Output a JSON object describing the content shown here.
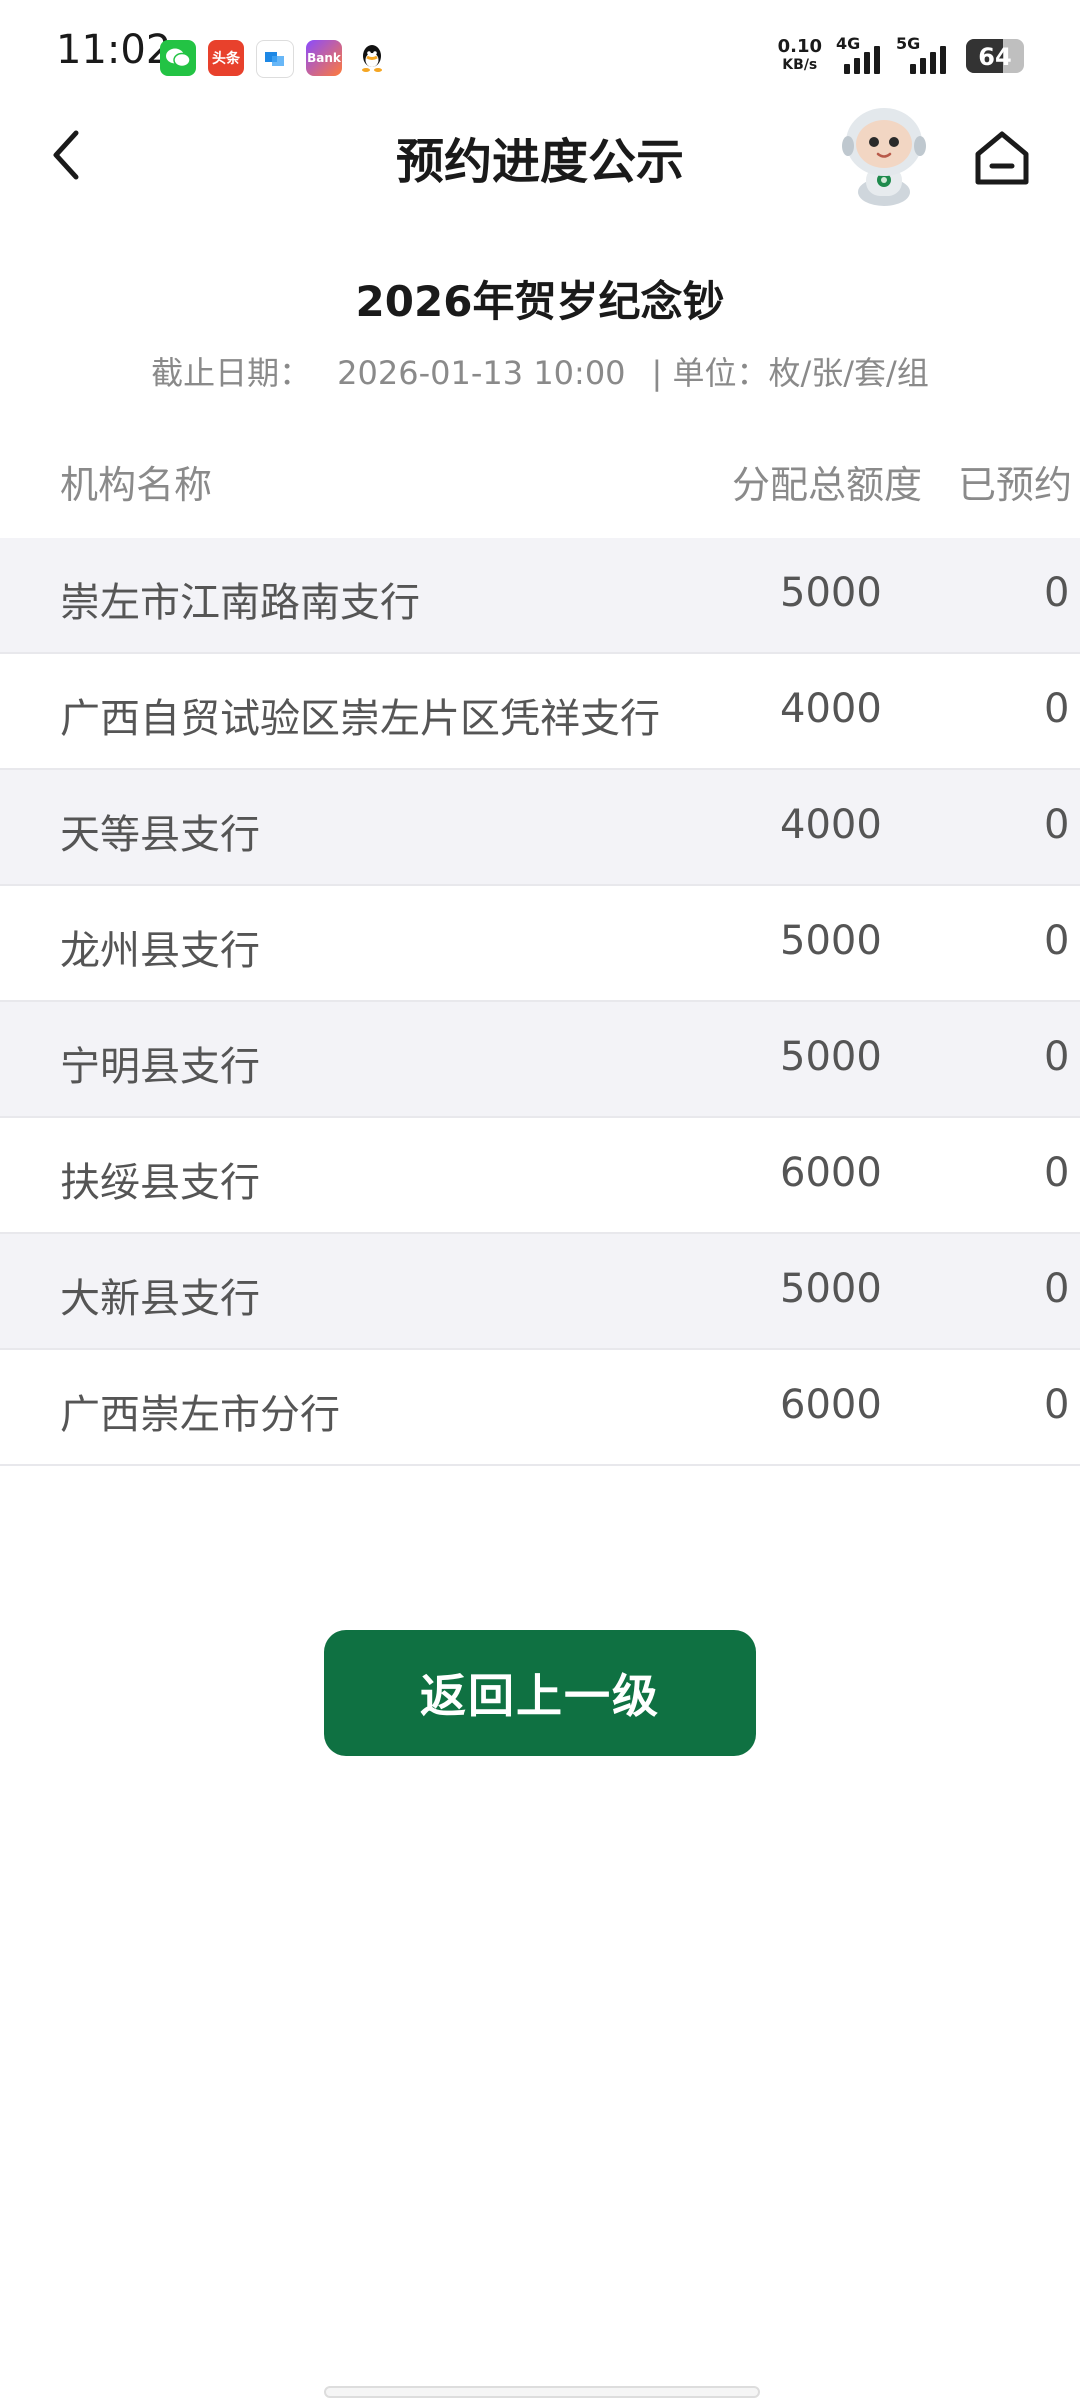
{
  "status_bar": {
    "time": "11:02",
    "net_speed_value": "0.10",
    "net_speed_unit": "KB/s",
    "signal_1_label": "4G",
    "signal_2_label": "5G",
    "battery": "64",
    "battery_level": 0.64,
    "notification_icons": [
      "wechat-icon",
      "toutiao-icon",
      "app-icon",
      "bank-app-icon",
      "qq-icon"
    ],
    "toutiao_label": "头条",
    "bank_label": "Bank"
  },
  "header": {
    "title": "预约进度公示",
    "back_icon": "chevron-left-icon",
    "mascot_icon": "robot-mascot-icon",
    "home_icon": "home-icon"
  },
  "notice": {
    "title": "2026年贺岁纪念钞",
    "deadline_label": "截止日期：",
    "deadline_value": "2026-01-13 10:00",
    "unit_label": "| 单位：枚/张/套/组"
  },
  "table": {
    "headers": {
      "name": "机构名称",
      "total": "分配总额度",
      "reserved": "已预约"
    },
    "rows": [
      {
        "name": "崇左市江南路南支行",
        "total": "5000",
        "reserved": "0"
      },
      {
        "name": "广西自贸试验区崇左片区凭祥支行",
        "total": "4000",
        "reserved": "0"
      },
      {
        "name": "天等县支行",
        "total": "4000",
        "reserved": "0"
      },
      {
        "name": "龙州县支行",
        "total": "5000",
        "reserved": "0"
      },
      {
        "name": "宁明县支行",
        "total": "5000",
        "reserved": "0"
      },
      {
        "name": "扶绥县支行",
        "total": "6000",
        "reserved": "0"
      },
      {
        "name": "大新县支行",
        "total": "5000",
        "reserved": "0"
      },
      {
        "name": "广西崇左市分行",
        "total": "6000",
        "reserved": "0"
      }
    ]
  },
  "actions": {
    "back_level_label": "返回上一级"
  },
  "colors": {
    "primary_green": "#0f7142",
    "row_alt_bg": "#f3f3f7",
    "muted_text": "#8a8a8a"
  }
}
